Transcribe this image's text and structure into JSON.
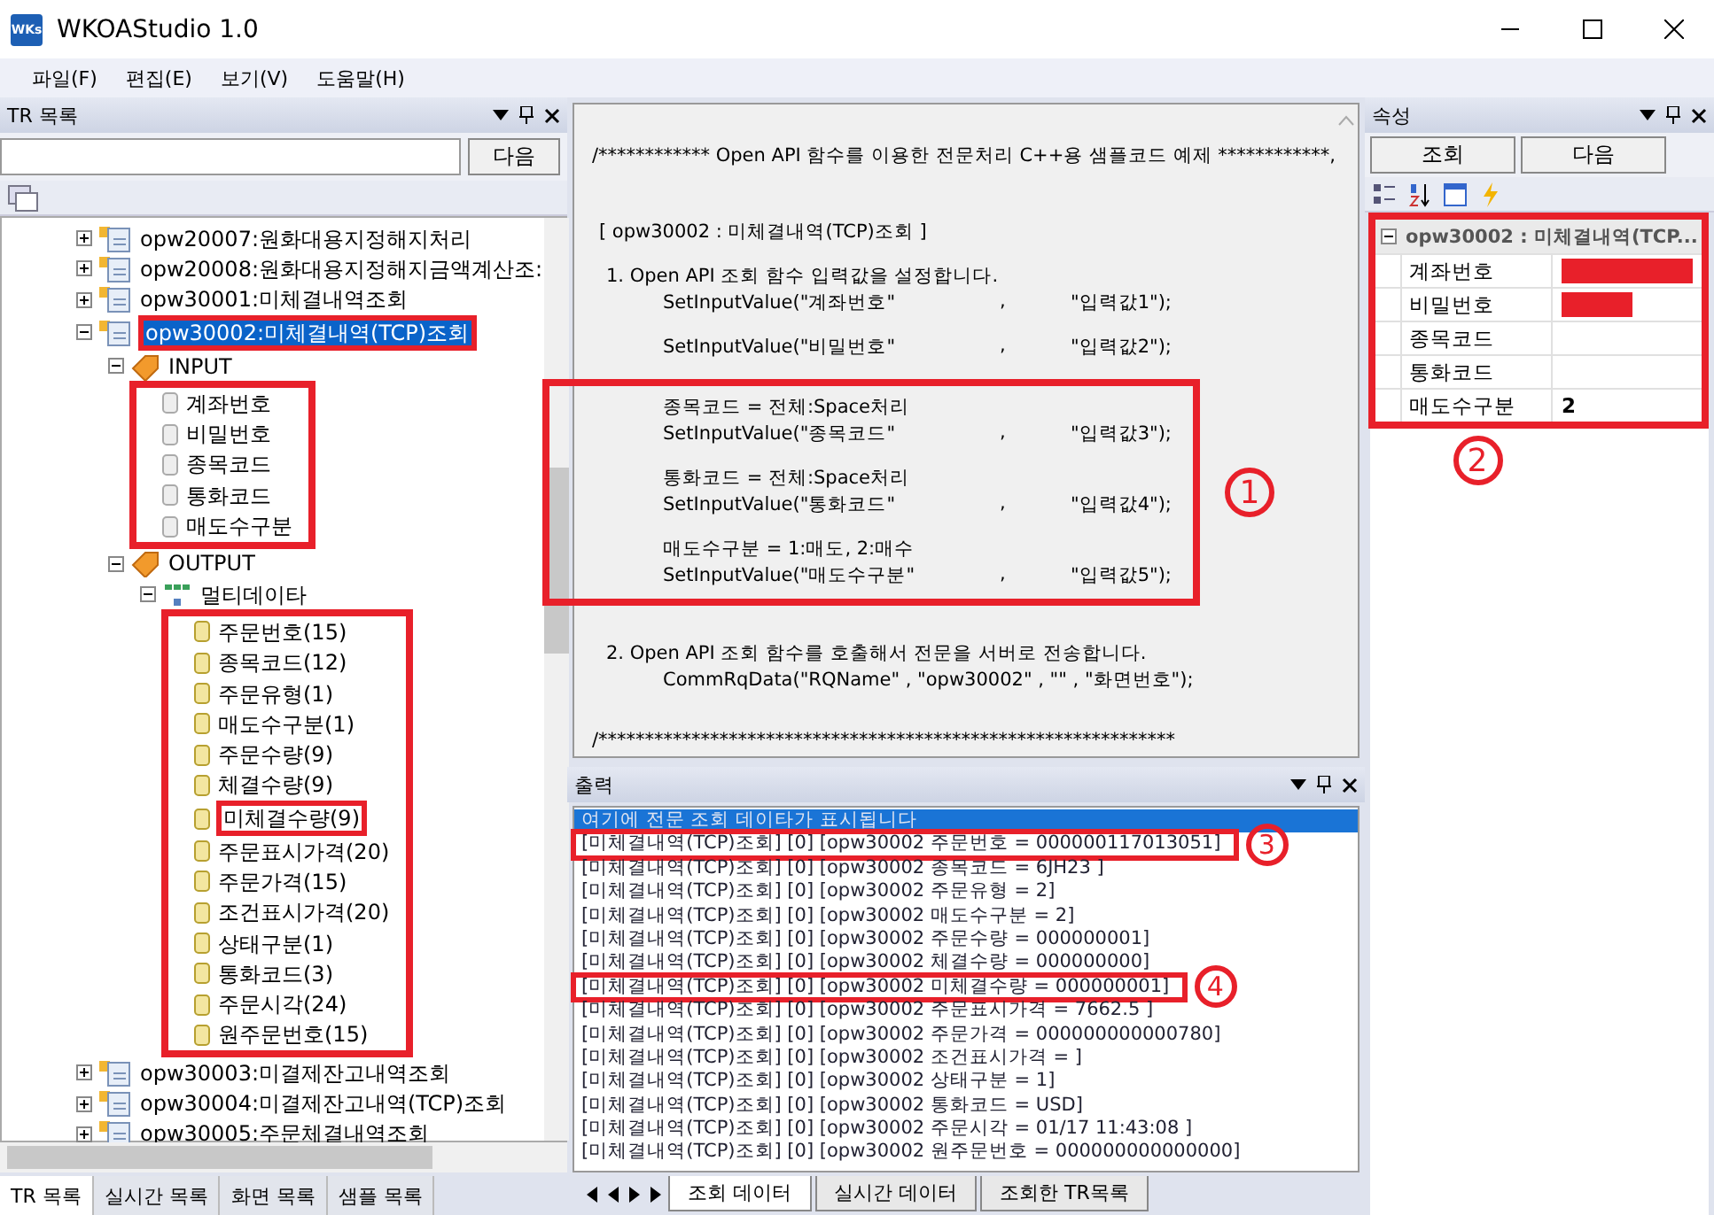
{
  "window": {
    "title": "WKOAStudio 1.0",
    "logo": "WKs"
  },
  "menu": [
    "파일(F)",
    "편집(E)",
    "보기(V)",
    "도움말(H)"
  ],
  "tr_panel": {
    "title": "TR 목록",
    "next_button": "다음",
    "tree": [
      {
        "label": "opw20007:원화대용지정해지처리",
        "kind": "tr",
        "expanded": false,
        "selected": false
      },
      {
        "label": "opw20008:원화대용지정해지금액계산조:",
        "kind": "tr",
        "expanded": false,
        "selected": false
      },
      {
        "label": "opw30001:미체결내역조회",
        "kind": "tr",
        "expanded": false,
        "selected": false
      },
      {
        "label": "opw30002:미체결내역(TCP)조회",
        "kind": "tr",
        "expanded": true,
        "selected": true,
        "annotated": true,
        "children": [
          {
            "label": "INPUT",
            "kind": "group",
            "expanded": true,
            "selected": false,
            "annotated_children": true,
            "children": [
              {
                "label": "계좌번호",
                "kind": "input",
                "selected": false
              },
              {
                "label": "비밀번호",
                "kind": "input",
                "selected": false
              },
              {
                "label": "종목코드",
                "kind": "input",
                "selected": false
              },
              {
                "label": "통화코드",
                "kind": "input",
                "selected": false
              },
              {
                "label": "매도수구분",
                "kind": "input",
                "selected": false
              }
            ]
          },
          {
            "label": "OUTPUT",
            "kind": "group",
            "expanded": true,
            "selected": false,
            "children": [
              {
                "label": "멀티데이타",
                "kind": "multi",
                "expanded": true,
                "selected": false,
                "annotated_children": true,
                "children": [
                  {
                    "label": "주문번호(15)",
                    "kind": "output",
                    "selected": false
                  },
                  {
                    "label": "종목코드(12)",
                    "kind": "output",
                    "selected": false
                  },
                  {
                    "label": "주문유형(1)",
                    "kind": "output",
                    "selected": false
                  },
                  {
                    "label": "매도수구분(1)",
                    "kind": "output",
                    "selected": false
                  },
                  {
                    "label": "주문수량(9)",
                    "kind": "output",
                    "selected": false
                  },
                  {
                    "label": "체결수량(9)",
                    "kind": "output",
                    "selected": false
                  },
                  {
                    "label": "미체결수량(9)",
                    "kind": "output",
                    "selected": false,
                    "annotated": true
                  },
                  {
                    "label": "주문표시가격(20)",
                    "kind": "output",
                    "selected": false
                  },
                  {
                    "label": "주문가격(15)",
                    "kind": "output",
                    "selected": false
                  },
                  {
                    "label": "조건표시가격(20)",
                    "kind": "output",
                    "selected": false
                  },
                  {
                    "label": "상태구분(1)",
                    "kind": "output",
                    "selected": false
                  },
                  {
                    "label": "통화코드(3)",
                    "kind": "output",
                    "selected": false
                  },
                  {
                    "label": "주문시각(24)",
                    "kind": "output",
                    "selected": false
                  },
                  {
                    "label": "원주문번호(15)",
                    "kind": "output",
                    "selected": false
                  }
                ]
              }
            ]
          }
        ]
      },
      {
        "label": "opw30003:미결제잔고내역조회",
        "kind": "tr",
        "expanded": false,
        "selected": false
      },
      {
        "label": "opw30004:미결제잔고내역(TCP)조회",
        "kind": "tr",
        "expanded": false,
        "selected": false
      },
      {
        "label": "opw30005:주문체결내역조회",
        "kind": "tr",
        "expanded": false,
        "selected": false
      }
    ],
    "tabs": [
      {
        "label": "TR 목록",
        "selected": true
      },
      {
        "label": "실시간 목록",
        "selected": false
      },
      {
        "label": "화면 목록",
        "selected": false
      },
      {
        "label": "샘플 목록",
        "selected": false
      }
    ]
  },
  "code": {
    "header": "/************ Open API 함수를 이용한 전문처리 C++용 샘플코드 예제 ************,",
    "title": "[ opw30002 : 미체결내역(TCP)조회 ]",
    "steps": [
      {
        "heading": "1. Open API 조회 함수 입력값을 설정합니다.",
        "blocks": [
          {
            "lines": [
              {
                "kind": "call",
                "call": "SetInputValue(\"계좌번호\"",
                "sep": ",",
                "arg": "\"입력값1\");"
              }
            ]
          },
          {
            "lines": [
              {
                "kind": "call",
                "call": "SetInputValue(\"비밀번호\"",
                "sep": ",",
                "arg": "\"입력값2\");"
              }
            ]
          },
          {
            "annotation": "1",
            "lines": [
              {
                "kind": "note",
                "text": "종목코드 = 전체:Space처리"
              },
              {
                "kind": "call",
                "call": "SetInputValue(\"종목코드\"",
                "sep": ",",
                "arg": "\"입력값3\");"
              },
              {
                "kind": "blank"
              },
              {
                "kind": "note",
                "text": "통화코드 = 전체:Space처리"
              },
              {
                "kind": "call",
                "call": "SetInputValue(\"통화코드\"",
                "sep": ",",
                "arg": "\"입력값4\");"
              },
              {
                "kind": "blank"
              },
              {
                "kind": "note",
                "text": "매도수구분 = 1:매도, 2:매수"
              },
              {
                "kind": "call",
                "call": "SetInputValue(\"매도수구분\"",
                "sep": ",",
                "arg": "\"입력값5\");"
              }
            ]
          }
        ]
      },
      {
        "heading": "2. Open API 조회 함수를 호출해서 전문을 서버로 전송합니다.",
        "blocks": [
          {
            "lines": [
              {
                "kind": "note",
                "text": "CommRqData(\"RQName\"  ,  \"opw30002\"  ,  \"\"  ,  \"화면번호\");"
              }
            ]
          }
        ]
      }
    ],
    "footer": "/**************************************************************"
  },
  "output": {
    "title": "출력",
    "lines": [
      {
        "text": "여기에 전문 조회 데이타가 표시됩니다",
        "selected": true
      },
      {
        "text": "[미체결내역(TCP)조회] [0] [opw30002 주문번호 = 000000117013051]",
        "selected": false,
        "annotation": "3"
      },
      {
        "text": "[미체결내역(TCP)조회] [0] [opw30002 종목코드 = 6JH23       ]",
        "selected": false
      },
      {
        "text": "[미체결내역(TCP)조회] [0] [opw30002 주문유형 = 2]",
        "selected": false
      },
      {
        "text": "[미체결내역(TCP)조회] [0] [opw30002 매도수구분 = 2]",
        "selected": false
      },
      {
        "text": "[미체결내역(TCP)조회] [0] [opw30002 주문수량 = 000000001]",
        "selected": false
      },
      {
        "text": "[미체결내역(TCP)조회] [0] [opw30002 체결수량 = 000000000]",
        "selected": false
      },
      {
        "text": "[미체결내역(TCP)조회] [0] [opw30002 미체결수량 = 000000001]",
        "selected": false,
        "annotation": "4"
      },
      {
        "text": "[미체결내역(TCP)조회] [0] [opw30002 주문표시가격 = 7662.5         ]",
        "selected": false
      },
      {
        "text": "[미체결내역(TCP)조회] [0] [opw30002 주문가격 = 000000000000780]",
        "selected": false
      },
      {
        "text": "[미체결내역(TCP)조회] [0] [opw30002 조건표시가격 =                    ]",
        "selected": false
      },
      {
        "text": "[미체결내역(TCP)조회] [0] [opw30002 상태구분 = 1]",
        "selected": false
      },
      {
        "text": "[미체결내역(TCP)조회] [0] [opw30002 통화코드 = USD]",
        "selected": false
      },
      {
        "text": "[미체결내역(TCP)조회] [0] [opw30002 주문시각 = 01/17 11:43:08           ]",
        "selected": false
      },
      {
        "text": "[미체결내역(TCP)조회] [0] [opw30002 원주문번호 = 000000000000000]",
        "selected": false
      }
    ],
    "tabs": [
      {
        "label": "조회 데이터",
        "selected": true
      },
      {
        "label": "실시간 데이터",
        "selected": false
      },
      {
        "label": "조회한 TR목록",
        "selected": false
      }
    ]
  },
  "properties": {
    "title": "속성",
    "buttons": [
      "조회",
      "다음"
    ],
    "group": "opw30002 : 미체결내역(TCP...",
    "expanded": true,
    "annotation": "2",
    "rows": [
      {
        "name": "계좌번호",
        "redacted": true
      },
      {
        "name": "비밀번호",
        "redacted": true
      },
      {
        "name": "종목코드",
        "redacted": false
      },
      {
        "name": "통화코드",
        "redacted": false
      },
      {
        "name": "매도수구분",
        "value": "2",
        "redacted": false
      }
    ]
  }
}
